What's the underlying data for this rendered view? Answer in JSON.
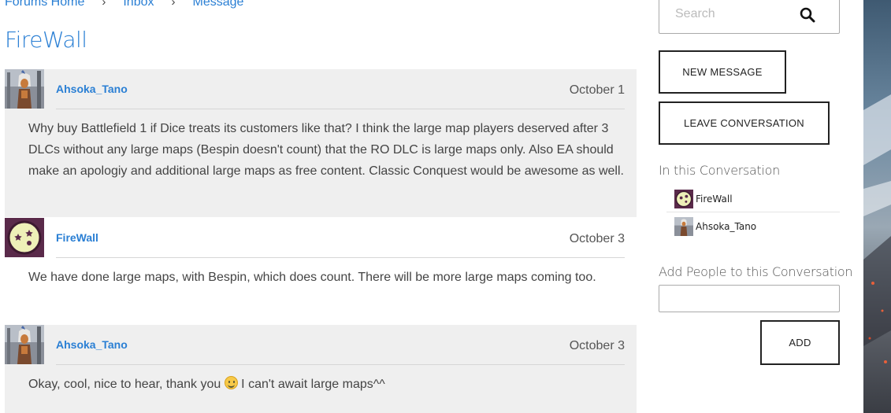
{
  "breadcrumb": {
    "items": [
      "Forums Home",
      "Inbox",
      "Message"
    ],
    "separator": "›"
  },
  "page": {
    "title": "FireWall"
  },
  "messages": [
    {
      "author": "Ahsoka_Tano",
      "date": "October 1",
      "body": "Why buy Battlefield 1 if Dice treats its customers like that? I think the large map players deserved after 3 DLCs without any large maps (Bespin doesn't count) that the RO DLC is large maps only. Also EA should make an apologiy and additional large maps as free content. Classic Conquest would be awesome as well."
    },
    {
      "author": "FireWall",
      "date": "October 3",
      "body": "We have done large maps, with Bespin, which does count. There will be more large maps coming too."
    },
    {
      "author": "Ahsoka_Tano",
      "date": "October 3",
      "body_before": "Okay, cool, nice to hear, thank you ",
      "body_after": " I can't await large maps^^"
    }
  ],
  "sidebar": {
    "search_placeholder": "Search",
    "new_message_label": "NEW MESSAGE",
    "leave_label": "LEAVE CONVERSATION",
    "in_conversation_heading": "In this Conversation",
    "participants": [
      "FireWall",
      "Ahsoka_Tano"
    ],
    "add_people_heading": "Add People to this Conversation",
    "add_label": "ADD"
  },
  "colors": {
    "link": "#2a7fd4",
    "message_bg": "#efefef",
    "firewall_avatar_bg": "#5a2a4a",
    "firewall_avatar_face": "#eef0b8"
  }
}
